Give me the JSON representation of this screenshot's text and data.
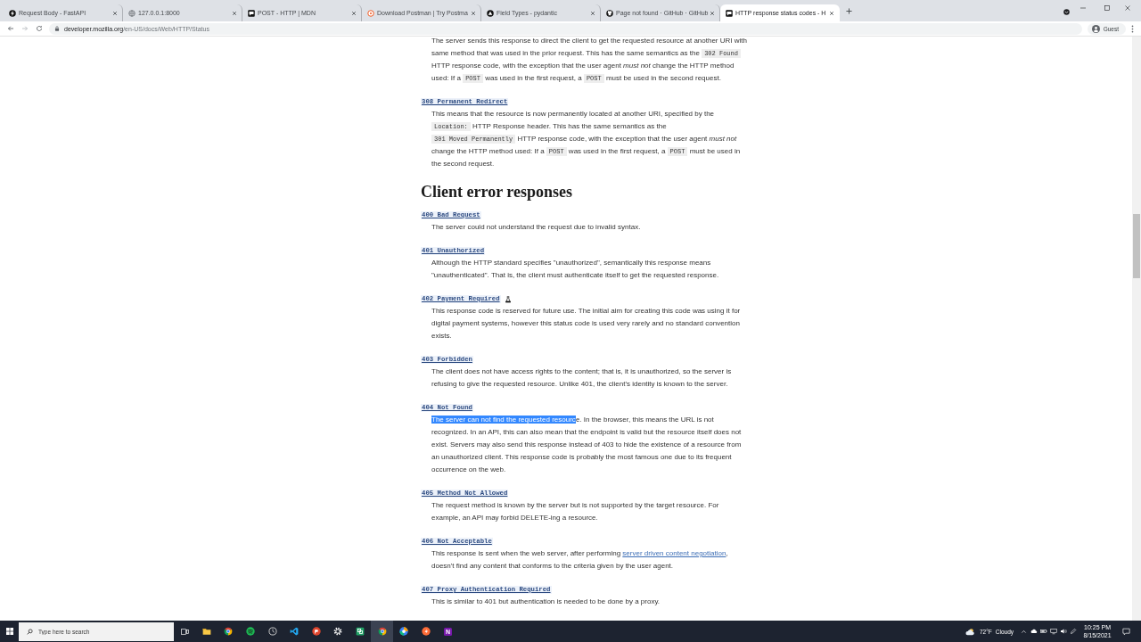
{
  "browser": {
    "tabs": [
      {
        "title": "Request Body - FastAPI",
        "selected": false
      },
      {
        "title": "127.0.0.1:8000",
        "selected": false
      },
      {
        "title": "POST - HTTP | MDN",
        "selected": false
      },
      {
        "title": "Download Postman | Try Postma",
        "selected": false
      },
      {
        "title": "Field Types - pydantic",
        "selected": false
      },
      {
        "title": "Page not found · GitHub · GitHub",
        "selected": false
      },
      {
        "title": "HTTP response status codes - H",
        "selected": true
      }
    ],
    "address": {
      "host": "developer.mozilla.org",
      "path": "/en-US/docs/Web/HTTP/Status"
    },
    "profile": "Guest"
  },
  "article": {
    "blocks": [
      {
        "kind": "definition",
        "segments": [
          {
            "kind": "text",
            "text": "The server sends this response to direct the client to get the requested resource at another URI with same method that was used in the prior request. This has the same semantics as the "
          },
          {
            "kind": "code",
            "text": "302 Found"
          },
          {
            "kind": "text",
            "text": " HTTP response code, with the exception that the user agent *must not* change the HTTP method used: If a "
          },
          {
            "kind": "code",
            "text": "POST"
          },
          {
            "kind": "text",
            "text": " was used in the first request, a "
          },
          {
            "kind": "code",
            "text": "POST"
          },
          {
            "kind": "text",
            "text": " must be used in the second request."
          }
        ]
      },
      {
        "kind": "definition",
        "term": "308 Permanent Redirect",
        "experimental": false,
        "segments": [
          {
            "kind": "text",
            "text": "This means that the resource is now permanently located at another URI, specified by the "
          },
          {
            "kind": "code",
            "text": "Location:"
          },
          {
            "kind": "text",
            "text": " HTTP Response header. This has the same semantics as the "
          },
          {
            "kind": "code",
            "text": "301 Moved Permanently"
          },
          {
            "kind": "text",
            "text": " HTTP response code, with the exception that the user agent *must not* change the HTTP method used: If a "
          },
          {
            "kind": "code",
            "text": "POST"
          },
          {
            "kind": "text",
            "text": " was used in the first request, a "
          },
          {
            "kind": "code",
            "text": "POST"
          },
          {
            "kind": "text",
            "text": " must be used in the second request."
          }
        ]
      },
      {
        "kind": "heading",
        "text": "Client error responses"
      },
      {
        "kind": "definition",
        "term": "400 Bad Request",
        "experimental": false,
        "segments": [
          {
            "kind": "text",
            "text": "The server could not understand the request due to invalid syntax."
          }
        ]
      },
      {
        "kind": "definition",
        "term": "401 Unauthorized",
        "experimental": false,
        "segments": [
          {
            "kind": "text",
            "text": "Although the HTTP standard specifies \"unauthorized\", semantically this response means \"unauthenticated\". That is, the client must authenticate itself to get the requested response."
          }
        ]
      },
      {
        "kind": "definition",
        "term": "402 Payment Required",
        "experimental": true,
        "segments": [
          {
            "kind": "text",
            "text": "This response code is reserved for future use. The initial aim for creating this code was using it for digital payment systems, however this status code is used very rarely and no standard convention exists."
          }
        ]
      },
      {
        "kind": "definition",
        "term": "403 Forbidden",
        "experimental": false,
        "segments": [
          {
            "kind": "text",
            "text": "The client does not have access rights to the content; that is, it is unauthorized, so the server is refusing to give the requested resource. Unlike 401, the client's identity is known to the server."
          }
        ]
      },
      {
        "kind": "definition",
        "term": "404 Not Found",
        "experimental": false,
        "segments": [
          {
            "kind": "selected",
            "text": "The server can not find the requested resourc"
          },
          {
            "kind": "text",
            "text": "e. In the browser, this means the URL is not recognized. In an API, this can also mean that the endpoint is valid but the resource itself does not exist. Servers may also send this response instead of 403 to hide the existence of a resource from an unauthorized client. This response code is probably the most famous one due to its frequent occurrence on the web."
          }
        ]
      },
      {
        "kind": "definition",
        "term": "405 Method Not Allowed",
        "experimental": false,
        "segments": [
          {
            "kind": "text",
            "text": "The request method is known by the server but is not supported by the target resource. For example, an API may forbid DELETE-ing a resource."
          }
        ]
      },
      {
        "kind": "definition",
        "term": "406 Not Acceptable",
        "experimental": false,
        "segments": [
          {
            "kind": "text",
            "text": "This response is sent when the web server, after performing "
          },
          {
            "kind": "link",
            "text": "server driven content negotiation"
          },
          {
            "kind": "text",
            "text": ", doesn't find any content that conforms to the criteria given by the user agent."
          }
        ]
      },
      {
        "kind": "definition",
        "term": "407 Proxy Authentication Required",
        "experimental": false,
        "segments": [
          {
            "kind": "text",
            "text": "This is similar to 401 but authentication is needed to be done by a proxy."
          }
        ]
      }
    ]
  },
  "taskbar": {
    "search": {
      "placeholder": "Type here to search"
    },
    "apps": [
      {
        "active": false
      },
      {
        "active": false
      },
      {
        "active": false
      },
      {
        "active": false
      },
      {
        "active": false
      },
      {
        "active": false
      },
      {
        "active": false
      },
      {
        "active": false
      },
      {
        "active": true
      },
      {
        "active": false
      },
      {
        "active": false
      },
      {
        "active": false,
        "glyph": "N"
      }
    ],
    "weather": {
      "temperature": "72°F",
      "condition": "Cloudy"
    },
    "clock": {
      "time": "10:25 PM",
      "date": "8/15/2021"
    }
  }
}
